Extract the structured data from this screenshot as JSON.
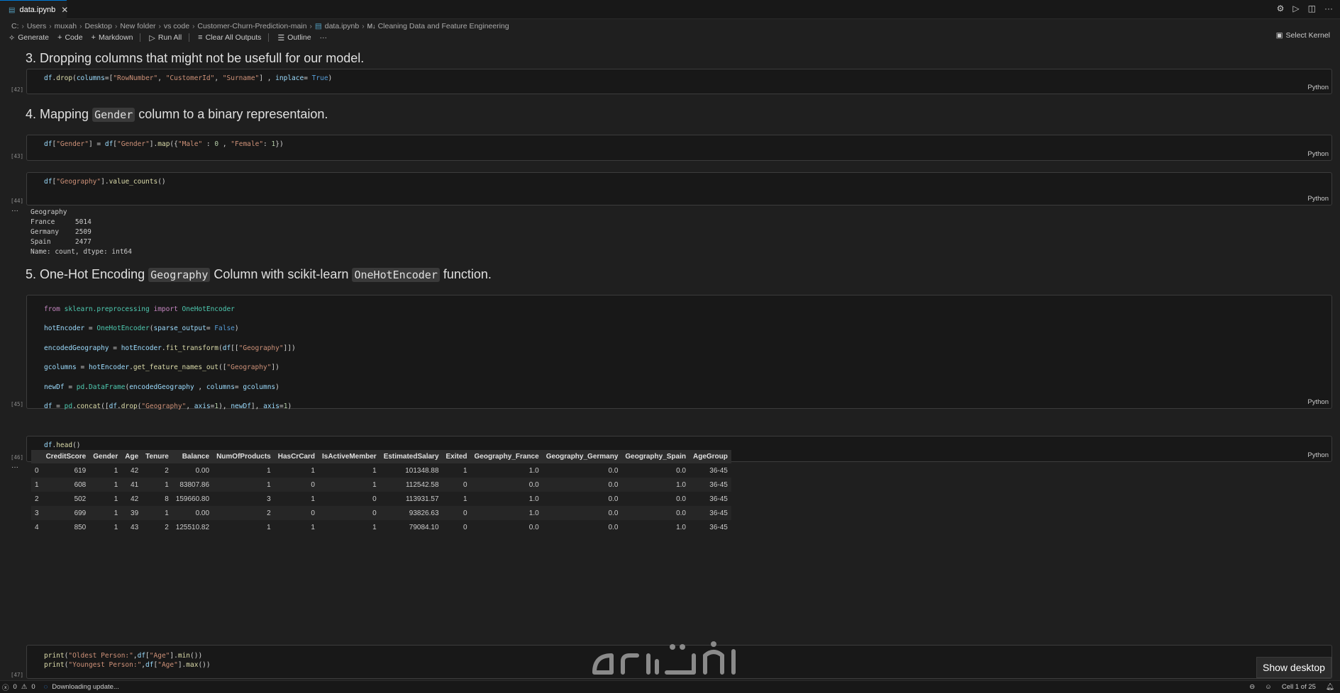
{
  "tab": {
    "filename": "data.ipynb",
    "close": "✕"
  },
  "breadcrumb": [
    "C:",
    "Users",
    "muxah",
    "Desktop",
    "New folder",
    "vs code",
    "Customer-Churn-Prediction-main",
    "data.ipynb",
    "Cleaning Data and Feature Engineering"
  ],
  "breadcrumb_md_prefix": "M↓",
  "toolbar": {
    "generate": "Generate",
    "code": "Code",
    "markdown": "Markdown",
    "run_all": "Run All",
    "clear_outputs": "Clear All Outputs",
    "outline": "Outline",
    "more": "···",
    "select_kernel": "Select Kernel"
  },
  "md": {
    "m3": "3. Dropping columns that might not be usefull for our model.",
    "m4_pre": "4. Mapping ",
    "m4_code": "Gender",
    "m4_post": " column to a binary representaion.",
    "m5_pre": "5. One-Hot Encoding ",
    "m5_code1": "Geography",
    "m5_mid": " Column with scikit-learn ",
    "m5_code2": "OneHotEncoder",
    "m5_post": " function."
  },
  "exec": {
    "c42": "[42]",
    "c43": "[43]",
    "c44": "[44]",
    "c45": "[45]",
    "c46": "[46]",
    "c47": "[47]"
  },
  "lang": "Python",
  "output_more": "···",
  "value_counts": "Geography\nFrance     5014\nGermany    2509\nSpain      2477\nName: count, dtype: int64",
  "df_head": {
    "columns": [
      "",
      "CreditScore",
      "Gender",
      "Age",
      "Tenure",
      "Balance",
      "NumOfProducts",
      "HasCrCard",
      "IsActiveMember",
      "EstimatedSalary",
      "Exited",
      "Geography_France",
      "Geography_Germany",
      "Geography_Spain",
      "AgeGroup"
    ],
    "rows": [
      [
        "0",
        "619",
        "1",
        "42",
        "2",
        "0.00",
        "1",
        "1",
        "1",
        "101348.88",
        "1",
        "1.0",
        "0.0",
        "0.0",
        "36-45"
      ],
      [
        "1",
        "608",
        "1",
        "41",
        "1",
        "83807.86",
        "1",
        "0",
        "1",
        "112542.58",
        "0",
        "0.0",
        "0.0",
        "1.0",
        "36-45"
      ],
      [
        "2",
        "502",
        "1",
        "42",
        "8",
        "159660.80",
        "3",
        "1",
        "0",
        "113931.57",
        "1",
        "1.0",
        "0.0",
        "0.0",
        "36-45"
      ],
      [
        "3",
        "699",
        "1",
        "39",
        "1",
        "0.00",
        "2",
        "0",
        "0",
        "93826.63",
        "0",
        "1.0",
        "0.0",
        "0.0",
        "36-45"
      ],
      [
        "4",
        "850",
        "1",
        "43",
        "2",
        "125510.82",
        "1",
        "1",
        "1",
        "79084.10",
        "0",
        "0.0",
        "0.0",
        "1.0",
        "36-45"
      ]
    ]
  },
  "status": {
    "errors": "0",
    "warnings": "0",
    "downloading": "Downloading update...",
    "cell": "Cell 1 of 25"
  },
  "show_desktop": "Show desktop"
}
